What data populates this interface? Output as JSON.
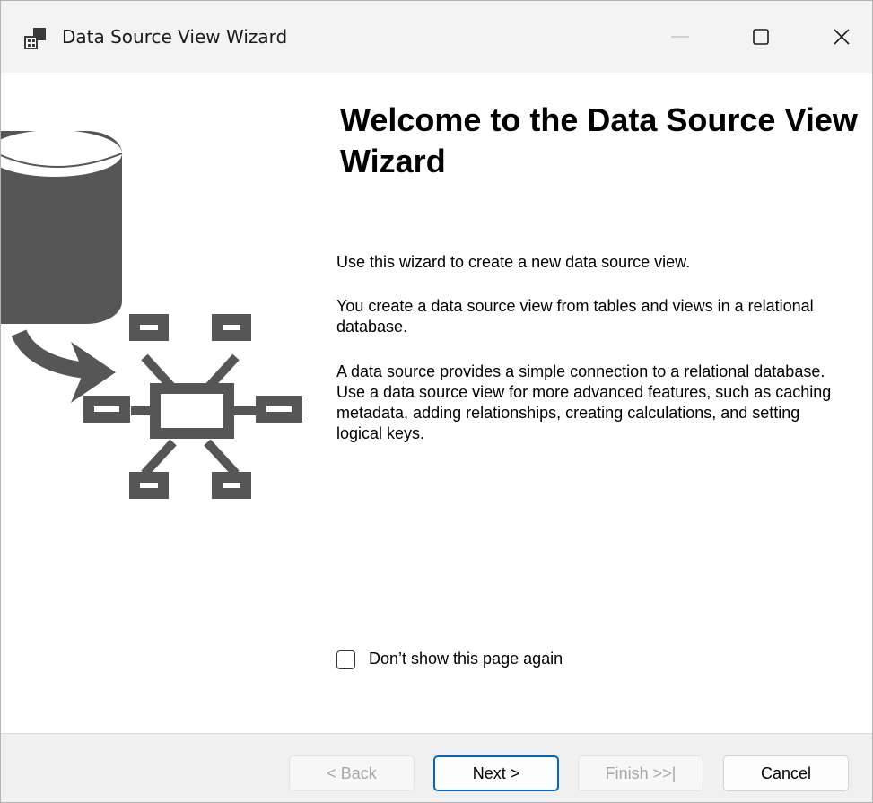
{
  "window": {
    "title": "Data Source View Wizard",
    "icons": {
      "app": "data-source-view-icon",
      "minimize": "minimize-icon",
      "maximize": "maximize-icon",
      "close": "close-icon"
    }
  },
  "illustration": {
    "icon": "database-to-schema-illustration",
    "color": "#565656"
  },
  "welcome": {
    "heading": "Welcome to the Data Source View Wizard",
    "paragraphs": [
      "Use this wizard to create a new data source view.",
      "You create a data source view from tables and views in a relational database.",
      "A data source provides a simple connection to a relational database. Use a data source view for more advanced features, such as caching metadata, adding relationships, creating calculations, and setting logical keys."
    ]
  },
  "options": {
    "dont_show_label": "Don’t show this page again",
    "dont_show_checked": false
  },
  "buttons": {
    "back": "< Back",
    "next": "Next >",
    "finish": "Finish >>|",
    "cancel": "Cancel"
  },
  "colors": {
    "accent": "#0067c0",
    "titlebar": "#f3f3f3",
    "footer": "#f0f0f0"
  }
}
